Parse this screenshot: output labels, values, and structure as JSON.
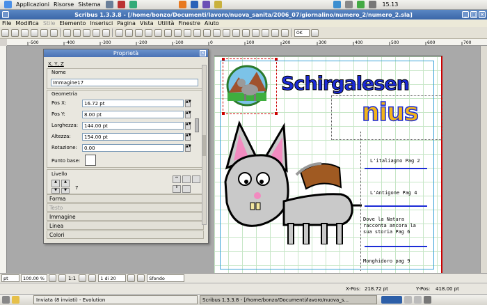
{
  "panel": {
    "menus": [
      "Applicazioni",
      "Risorse",
      "Sistema"
    ],
    "clock": "15.13"
  },
  "window": {
    "title": "Scribus 1.3.3.8 - [/home/bonzo/Documenti/lavoro/nuova_sanita/2006_07/giornalino/numero_2/numero_2.sla]"
  },
  "menubar": {
    "items": [
      "File",
      "Modifica",
      "Stile",
      "Elemento",
      "Inserisci",
      "Pagina",
      "Vista",
      "Utilità",
      "Finestre",
      "Aiuto"
    ]
  },
  "toolbar": {
    "zoom_mode": "OK"
  },
  "ruler": {
    "labels": [
      "-500",
      "-400",
      "-300",
      "-200",
      "-100",
      "0",
      "100",
      "200",
      "300",
      "400",
      "500",
      "600",
      "700",
      "800",
      "900",
      "1000",
      "1100"
    ]
  },
  "properties": {
    "title": "Proprietà",
    "tab_xyz": "X, Y, Z",
    "name_section": "Nome",
    "name_value": "Immagine17",
    "geometry_section": "Geometria",
    "pos_x_label": "Pos X:",
    "pos_x_value": "16.72 pt",
    "pos_y_label": "Pos Y:",
    "pos_y_value": "8.00 pt",
    "width_label": "Larghezza:",
    "width_value": "144.00 pt",
    "height_label": "Altezza:",
    "height_value": "154.00 pt",
    "rotation_label": "Rotazione:",
    "rotation_value": "0.00",
    "basepoint_label": "Punto base:",
    "level_label": "Livello",
    "level_value": "7",
    "sections": [
      "Forma",
      "Testo",
      "Immagine",
      "Linea",
      "Colori"
    ]
  },
  "document": {
    "title_line1": "Schirgalesen",
    "title_line2": "nius",
    "index": [
      "L'italiagno Pag 2",
      "L'Antigone Pag 4",
      "Dove la Natura racconta ancora la sua storia Pag 6",
      "Monghidoro pag 9"
    ]
  },
  "statusbar": {
    "unit": "pt",
    "zoom": "100.00 %",
    "ratio": "1:1",
    "page": "1 di 20",
    "layer": "Sfondo"
  },
  "coords": {
    "x_label": "X-Pos:",
    "x_value": "218.72 pt",
    "y_label": "Y-Pos:",
    "y_value": "418.00 pt"
  },
  "taskbar": {
    "tasks": [
      "Inviata (8 inviati) - Evolution",
      "Scribus 1.3.3.8 - [/home/bonzo/Documenti/lavoro/nuova_s..."
    ]
  },
  "colors": {
    "title_blue": "#1b2bd6",
    "title_yellow": "#f2b51a",
    "guide_red": "#cc0000",
    "grid_green": "#c6e6c6"
  }
}
